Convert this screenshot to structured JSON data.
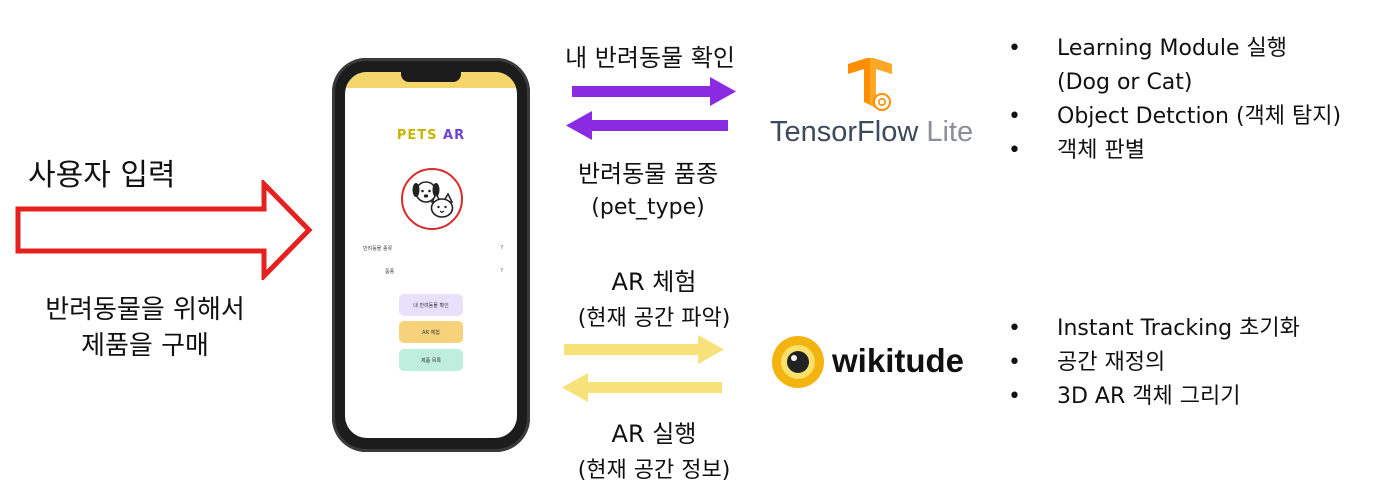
{
  "user_input_label": "사용자 입력",
  "purpose_lines": [
    "반려동물을 위해서",
    "제품을 구매"
  ],
  "colors": {
    "red_arrow": "#e61f1f",
    "purple_arrow": "#8a2be2",
    "yellow_arrow": "#f7e27a",
    "app_button_purple": "#e9e0fb",
    "app_button_yellow": "#f6d27a",
    "app_button_mint": "#bdeede"
  },
  "phone_app": {
    "title_part1": "PETS",
    "title_part2": "AR",
    "rows": [
      {
        "label": "반려동물 종류",
        "value": "?"
      },
      {
        "label": "품종",
        "value": "?"
      }
    ],
    "buttons": [
      "내 반려동물 확인",
      "AR 체험",
      "제품 목록"
    ]
  },
  "tensorflow_flow": {
    "request": "내 반려동물 확인",
    "response_line1": "반려동물 품종",
    "response_line2": "(pet_type)"
  },
  "ar_flow": {
    "request_line1": "AR 체험",
    "request_line2": "(현재 공간 파악)",
    "response_line1": "AR 실행",
    "response_line2": "(현재 공간 정보)"
  },
  "logos": {
    "tensorflow": {
      "main": "TensorFlow",
      "suffix": " Lite",
      "icon": "tensorflow-icon"
    },
    "wikitude": {
      "main": "wikitude",
      "icon": "wikitude-eye-icon"
    }
  },
  "tensorflow_bullets": {
    "b1": "Learning Module 실행",
    "b1_cont": "(Dog or Cat)",
    "b2": "Object Detction (객체 탐지)",
    "b3": "객체 판별"
  },
  "wikitude_bullets": {
    "b1": "Instant Tracking 초기화",
    "b2": "공간 재정의",
    "b3": "3D AR 객체 그리기"
  },
  "bullet_char": "•"
}
